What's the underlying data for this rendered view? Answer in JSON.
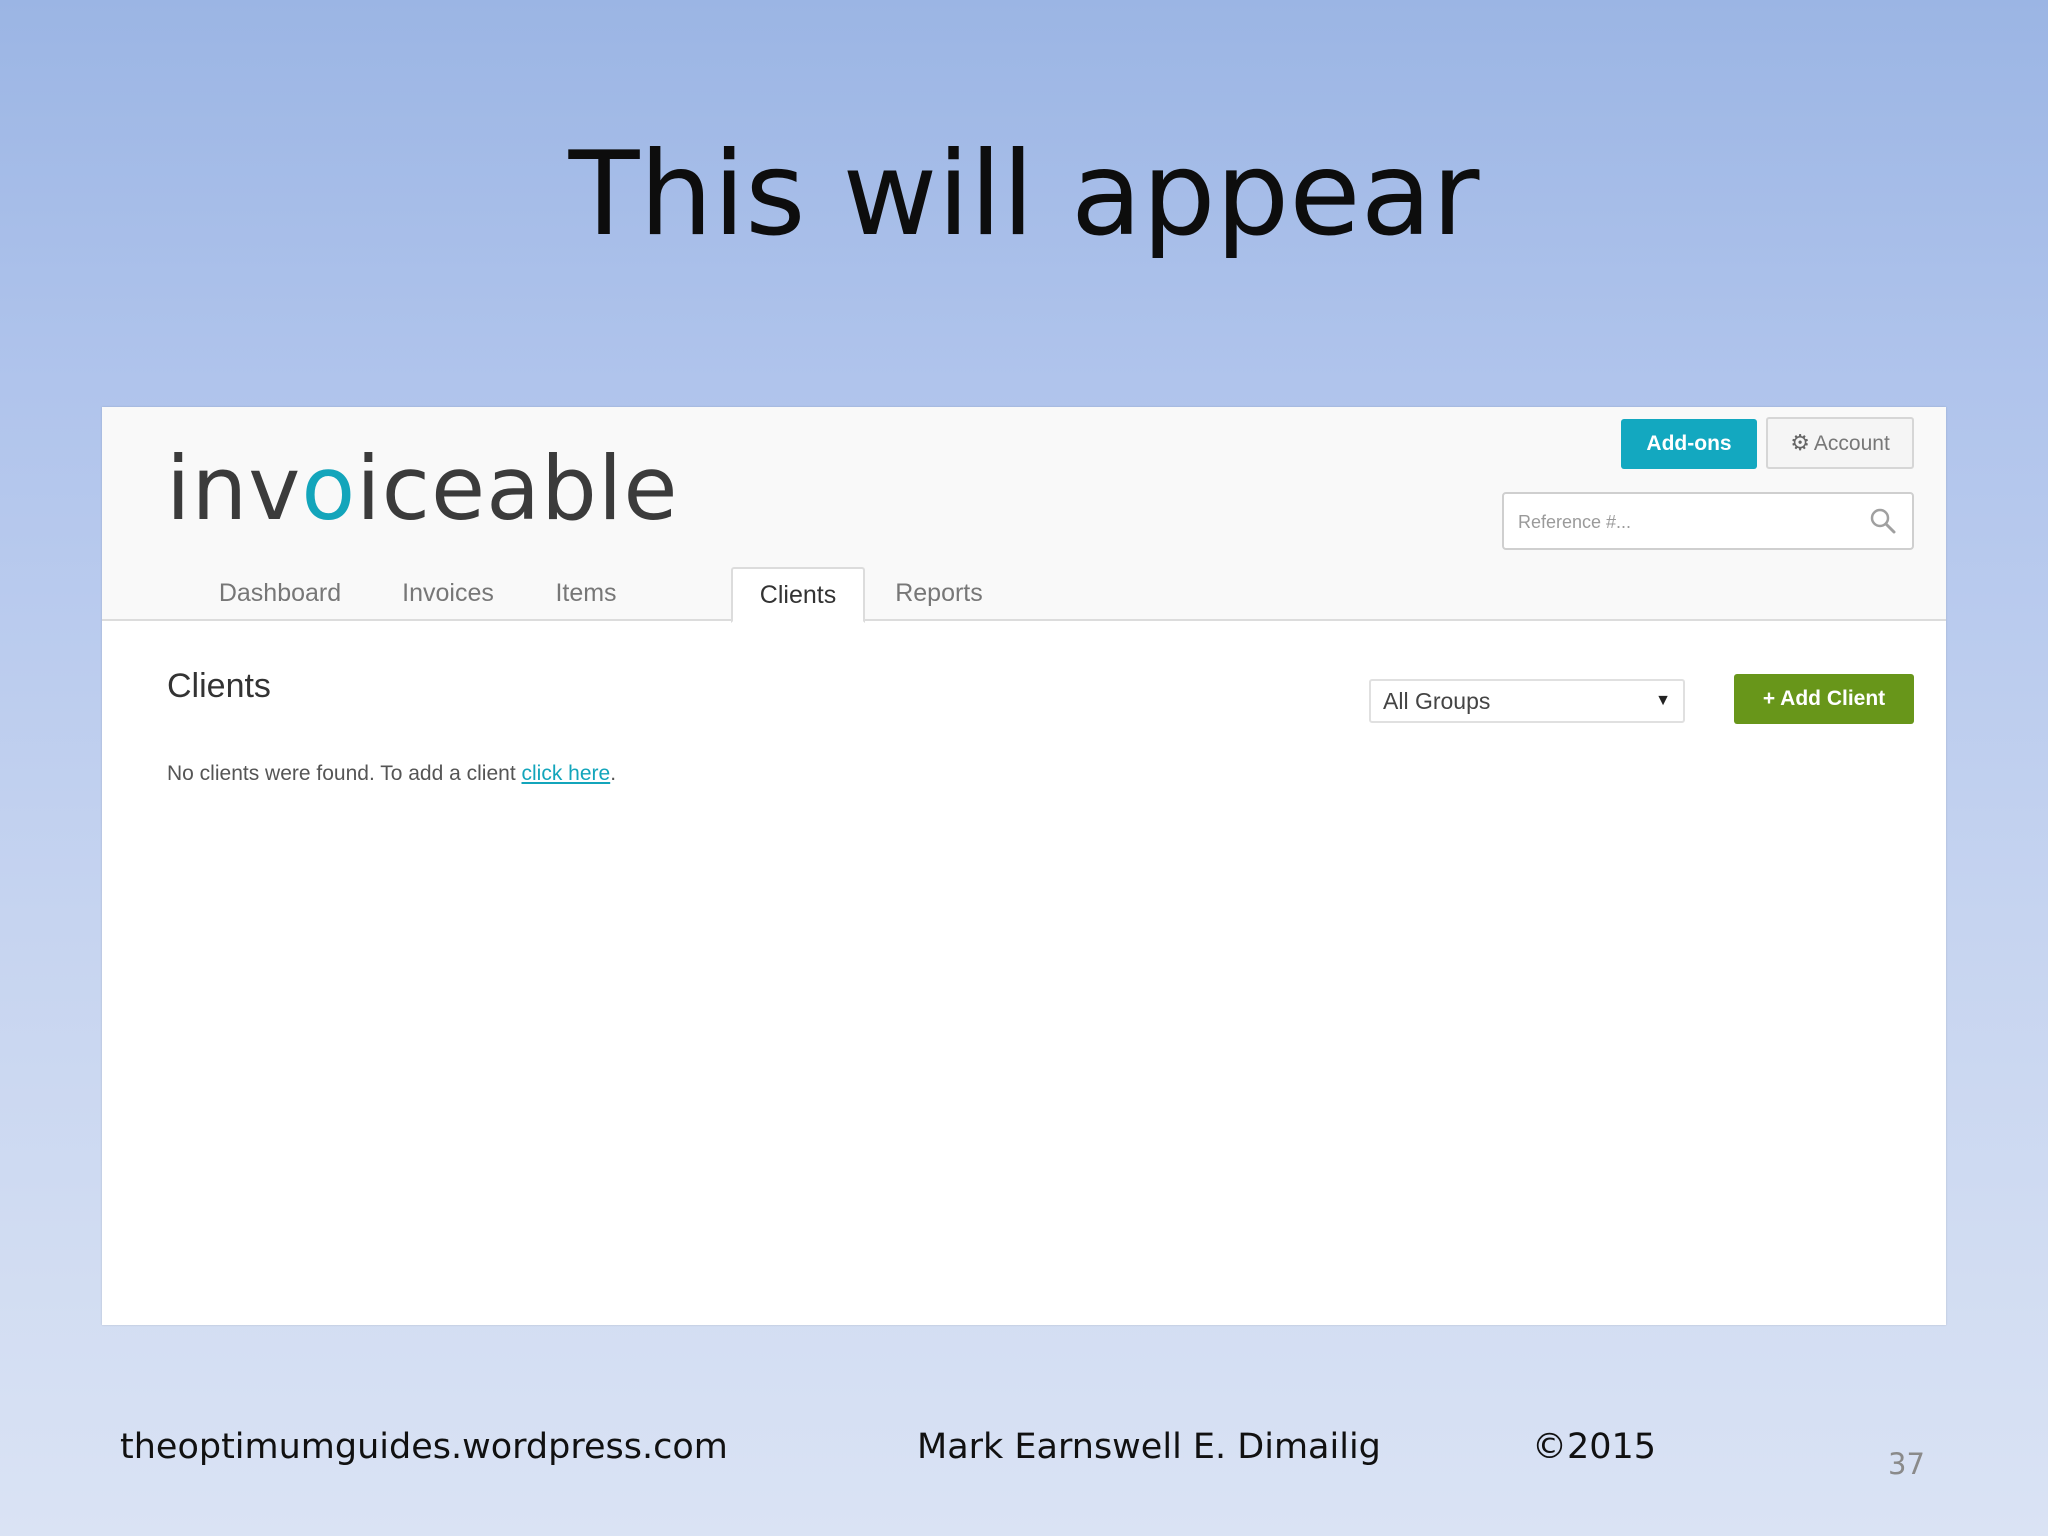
{
  "slide": {
    "title": "This will appear",
    "footer_site": "theoptimumguides.wordpress.com",
    "footer_author": "Mark Earnswell E. Dimailig",
    "footer_copyright": "©2015",
    "page_number": "37"
  },
  "app": {
    "logo": {
      "part1": "inv",
      "part2": "o",
      "part3": "iceable"
    },
    "header": {
      "addons_label": "Add-ons",
      "account_label": "Account",
      "search_placeholder": "Reference #..."
    },
    "tabs": [
      {
        "label": "Dashboard",
        "active": false
      },
      {
        "label": "Invoices",
        "active": false
      },
      {
        "label": "Items",
        "active": false
      },
      {
        "label": "Clients",
        "active": true
      },
      {
        "label": "Reports",
        "active": false
      }
    ],
    "clients_page": {
      "heading": "Clients",
      "group_filter_value": "All Groups",
      "add_client_label": "+ Add Client",
      "empty_message": "No clients were found. To add a client ",
      "empty_link": "click here",
      "empty_suffix": "."
    }
  },
  "colors": {
    "brand_teal": "#13a8c0",
    "add_green": "#68961a"
  },
  "icons": {
    "account": "gear-icon",
    "search": "search-icon",
    "select": "caret-down-icon"
  }
}
